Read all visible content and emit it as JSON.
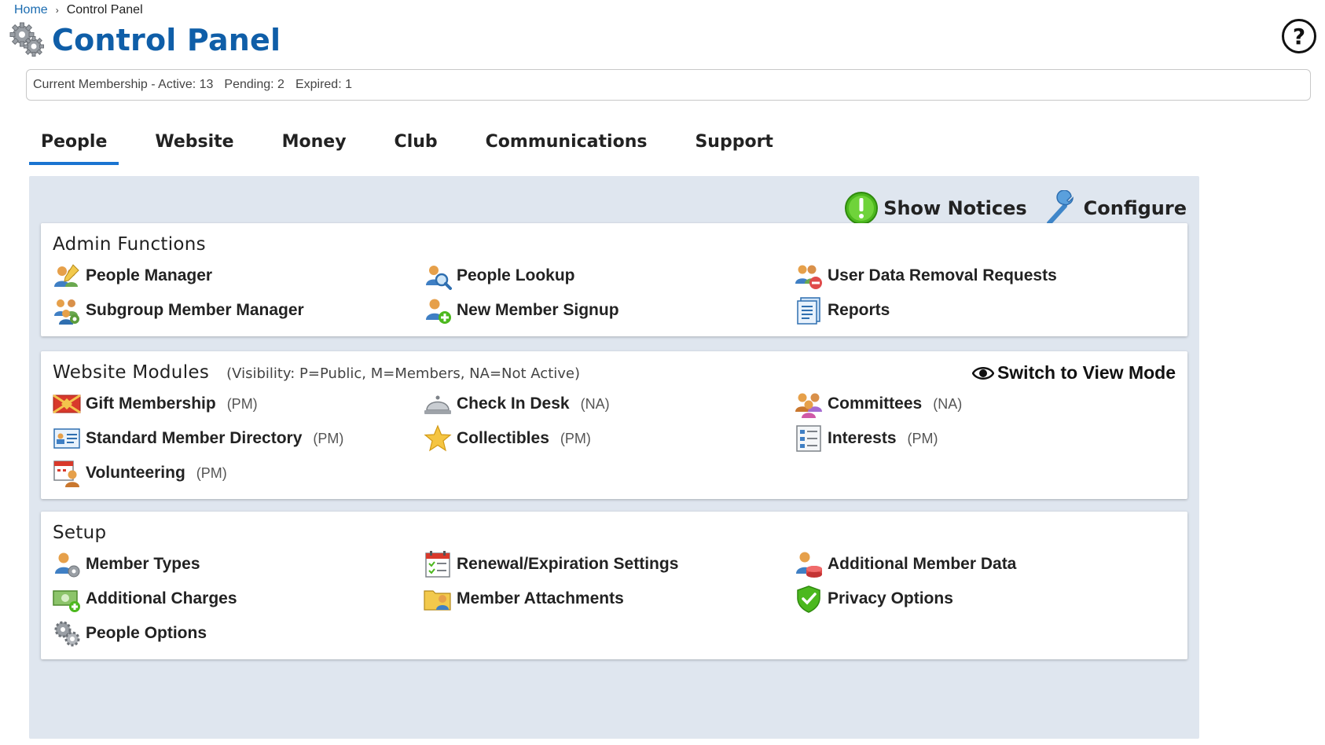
{
  "breadcrumb": {
    "home": "Home",
    "separator": "›",
    "current": "Control Panel"
  },
  "page": {
    "title": "Control Panel",
    "help": "?"
  },
  "membership": {
    "label": "Current Membership - Active: 13",
    "pending": "Pending: 2",
    "expired": "Expired: 1"
  },
  "tabs": [
    {
      "label": "People",
      "active": true
    },
    {
      "label": "Website"
    },
    {
      "label": "Money"
    },
    {
      "label": "Club"
    },
    {
      "label": "Communications"
    },
    {
      "label": "Support"
    }
  ],
  "actions": {
    "show_notices": "Show Notices",
    "configure": "Configure"
  },
  "admin": {
    "title": "Admin Functions",
    "items": [
      {
        "label": "People Manager",
        "icon": "people-manager-icon"
      },
      {
        "label": "People Lookup",
        "icon": "people-lookup-icon"
      },
      {
        "label": "User Data Removal Requests",
        "icon": "user-data-removal-icon"
      },
      {
        "label": "Subgroup Member Manager",
        "icon": "subgroup-icon"
      },
      {
        "label": "New Member Signup",
        "icon": "new-member-icon"
      },
      {
        "label": "Reports",
        "icon": "reports-icon"
      }
    ]
  },
  "modules": {
    "title": "Website Modules",
    "subtitle": "(Visibility: P=Public, M=Members, NA=Not Active)",
    "switch_mode": "Switch to View Mode",
    "items": [
      {
        "label": "Gift Membership",
        "vis": "(PM)",
        "icon": "gift-icon"
      },
      {
        "label": "Check In Desk",
        "vis": "(NA)",
        "icon": "bell-icon"
      },
      {
        "label": "Committees",
        "vis": "(NA)",
        "icon": "committees-icon"
      },
      {
        "label": "Standard Member Directory",
        "vis": "(PM)",
        "icon": "directory-icon"
      },
      {
        "label": "Collectibles",
        "vis": "(PM)",
        "icon": "star-icon"
      },
      {
        "label": "Interests",
        "vis": "(PM)",
        "icon": "interests-icon"
      },
      {
        "label": "Volunteering",
        "vis": "(PM)",
        "icon": "volunteering-icon"
      }
    ]
  },
  "setup": {
    "title": "Setup",
    "items": [
      {
        "label": "Member Types",
        "icon": "member-types-icon"
      },
      {
        "label": "Renewal/Expiration Settings",
        "icon": "calendar-icon"
      },
      {
        "label": "Additional Member Data",
        "icon": "additional-data-icon"
      },
      {
        "label": "Additional Charges",
        "icon": "money-icon"
      },
      {
        "label": "Member Attachments",
        "icon": "attachments-icon"
      },
      {
        "label": "Privacy Options",
        "icon": "shield-icon"
      },
      {
        "label": "People Options",
        "icon": "gears-icon"
      }
    ]
  },
  "colors": {
    "title": "#0f5ea8",
    "tab_underline": "#1a74d1",
    "panel_bg": "#dfe6ef",
    "link": "#1a6bb0"
  }
}
